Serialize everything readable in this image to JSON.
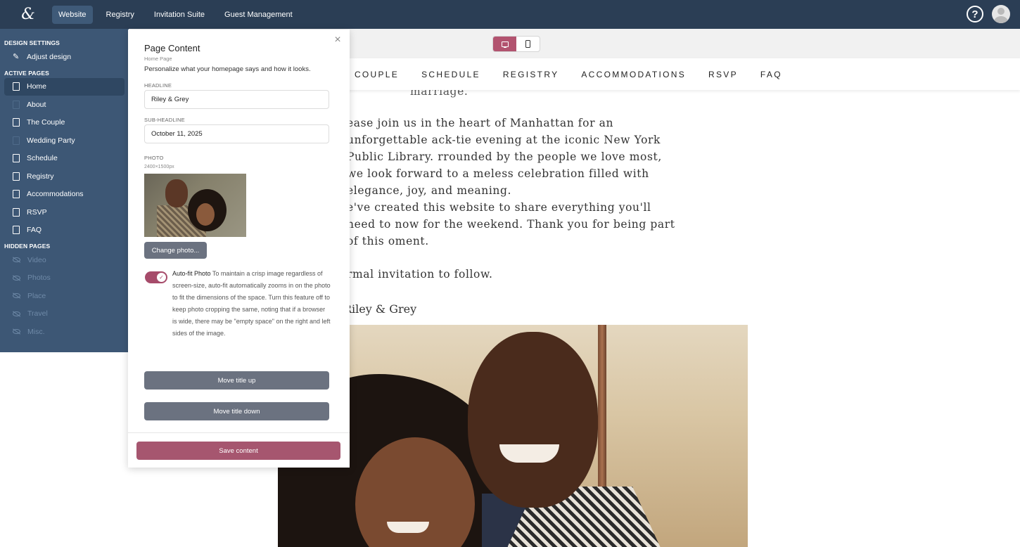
{
  "topbar": {
    "logo_glyph": "&",
    "nav": [
      "Website",
      "Registry",
      "Invitation Suite",
      "Guest Management"
    ],
    "help_glyph": "?"
  },
  "sidebar": {
    "design_section": "DESIGN SETTINGS",
    "adjust_design": "Adjust design",
    "active_section": "ACTIVE PAGES",
    "active_pages": [
      "Home",
      "About",
      "The Couple",
      "Wedding Party",
      "Schedule",
      "Registry",
      "Accommodations",
      "RSVP",
      "FAQ"
    ],
    "hidden_section": "HIDDEN PAGES",
    "hidden_pages": [
      "Video",
      "Photos",
      "Place",
      "Travel",
      "Misc."
    ]
  },
  "panel": {
    "title": "Page Content",
    "subtitle": "Home Page",
    "description": "Personalize what your homepage says and how it looks.",
    "headline_label": "HEADLINE",
    "headline_value": "Riley & Grey",
    "subheadline_label": "SUB-HEADLINE",
    "subheadline_value": "October 11, 2025",
    "photo_label": "PHOTO",
    "photo_dims": "2400×1500px",
    "change_photo": "Change photo...",
    "autofit_label": "Auto-fit Photo",
    "autofit_text": "To maintain a crisp image regardless of screen-size, auto-fit automatically zooms in on the photo to fit the dimensions of the space. Turn this feature off to keep photo cropping the same, noting that if a browser is wide, there may be \"empty space\" on the right and left sides of the image.",
    "autofit_on": true,
    "move_up": "Move title up",
    "move_down": "Move title down",
    "save": "Save content",
    "close_glyph": "×"
  },
  "preview": {
    "nav": [
      "E COUPLE",
      "SCHEDULE",
      "REGISTRY",
      "ACCOMMODATIONS",
      "RSVP",
      "FAQ"
    ],
    "top_fragment": "marriage.",
    "p1": "ease join us in the heart of Manhattan for an unforgettable ack-tie evening at the iconic New York Public Library. rrounded by the people we love most, we look forward to a meless celebration filled with elegance, joy, and meaning.",
    "p2": "e've created this website to share everything you'll need to now for the weekend. Thank you for being part of this oment.",
    "p3": "rmal invitation to follow.",
    "signature": "Riley & Grey"
  },
  "colors": {
    "topbar": "#2b3e55",
    "sidebar": "#3d5775",
    "accent": "#a6566f",
    "button_gray": "#6b7280"
  }
}
